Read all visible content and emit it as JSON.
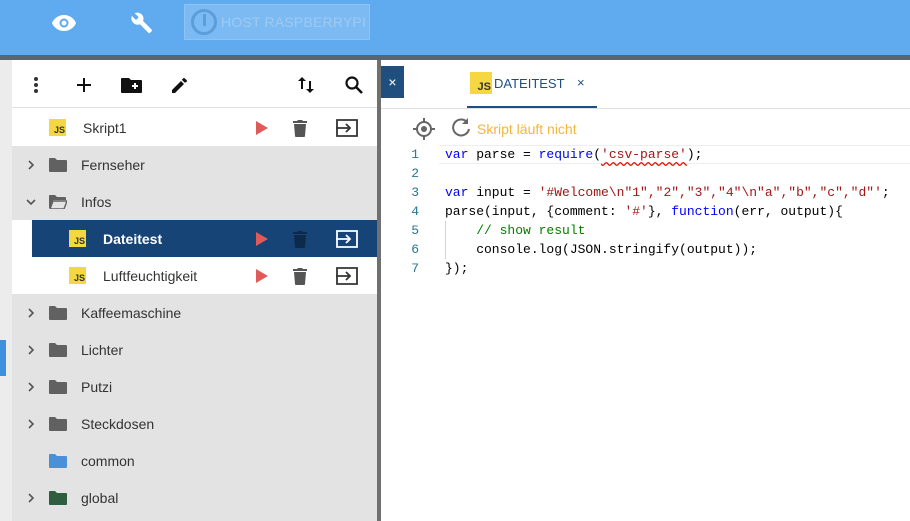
{
  "header": {
    "host_label": "HOST RASPBERRYPI",
    "icons": [
      "eye-icon",
      "wrench-icon",
      "iobroker-logo-icon"
    ]
  },
  "toolbar": {
    "icons": [
      "more-vertical-icon",
      "add-icon",
      "new-folder-icon",
      "edit-icon",
      "sort-icon",
      "search-icon"
    ]
  },
  "tree": {
    "items": [
      {
        "type": "script",
        "label": "Skript1",
        "level": 0
      },
      {
        "type": "folder",
        "label": "Fernseher",
        "level": 0,
        "expanded": false
      },
      {
        "type": "folder",
        "label": "Infos",
        "level": 0,
        "expanded": true
      },
      {
        "type": "script",
        "label": "Dateitest",
        "level": 1,
        "selected": true
      },
      {
        "type": "script",
        "label": "Luftfeuchtigkeit",
        "level": 1
      },
      {
        "type": "folder",
        "label": "Kaffeemaschine",
        "level": 0,
        "expanded": false
      },
      {
        "type": "folder",
        "label": "Lichter",
        "level": 0,
        "expanded": false
      },
      {
        "type": "folder",
        "label": "Putzi",
        "level": 0,
        "expanded": false
      },
      {
        "type": "folder",
        "label": "Steckdosen",
        "level": 0,
        "expanded": false
      },
      {
        "type": "folder",
        "label": "common",
        "level": 0,
        "color": "#4a90d9"
      },
      {
        "type": "folder",
        "label": "global",
        "level": 0,
        "expanded": false,
        "color": "#2e5e3e"
      }
    ]
  },
  "editor": {
    "close_label": "×",
    "tab": {
      "icon_text": "JS",
      "label": "DATEITEST",
      "close": "×"
    },
    "status": "Skript läuft nicht",
    "lines": [
      {
        "n": "1"
      },
      {
        "n": "2"
      },
      {
        "n": "3"
      },
      {
        "n": "4"
      },
      {
        "n": "5"
      },
      {
        "n": "6"
      },
      {
        "n": "7"
      }
    ],
    "code": {
      "l1_kw": "var",
      "l1_a": " parse = ",
      "l1_fn": "require",
      "l1_p": "(",
      "l1_str": "'csv-parse'",
      "l1_end": ");",
      "l3_kw": "var",
      "l3_a": " input = ",
      "l3_str": "'#Welcome\\n\"1\",\"2\",\"3\",\"4\"\\n\"a\",\"b\",\"c\",\"d\"'",
      "l3_end": ";",
      "l4_a": "parse(input, {comment: ",
      "l4_str": "'#'",
      "l4_b": "}, ",
      "l4_kw": "function",
      "l4_c": "(err, output){",
      "l5_cm": "    // show result",
      "l6": "    console.log(JSON.stringify(output));",
      "l7": "});"
    }
  },
  "colors": {
    "topbar": "#60aaf0",
    "selected_row": "#164477",
    "play": "#e05a5a",
    "status": "#f2b63a",
    "js_badge": "#f5d742"
  }
}
